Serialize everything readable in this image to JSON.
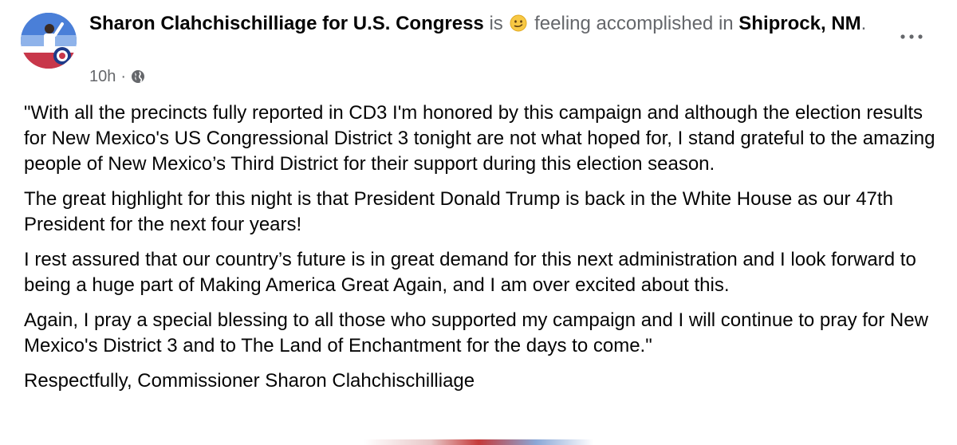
{
  "post": {
    "author": "Sharon Clahchischilliage for U.S. Congress",
    "is_text": "is",
    "feeling_emoji_icon": "smirk-face-emoji",
    "feeling_text": "feeling accomplished in",
    "location": "Shiprock, NM",
    "location_suffix": ".",
    "timestamp": "10h",
    "separator": "·",
    "privacy_icon": "globe-icon",
    "more_icon": "more-horizontal-icon",
    "paragraphs": [
      "\"With all the precincts fully reported in CD3 I'm honored by this campaign and although the election results for New Mexico's US Congressional District 3 tonight are not what hoped for, I stand grateful to the amazing people of New Mexico’s Third District for their support during this election season.",
      "The great highlight for this night is that President Donald Trump is back in the White House as our 47th President for the next four years!",
      "I rest assured that our country’s future is in great demand for this next administration and I look forward to being a huge part of Making America Great Again, and I am over excited about this.",
      "Again, I pray a special blessing to all those who supported my campaign and I will continue to pray for New Mexico's District 3 and to The Land of Enchantment for the days to come.\"",
      "Respectfully, Commissioner Sharon Clahchischilliage"
    ]
  }
}
